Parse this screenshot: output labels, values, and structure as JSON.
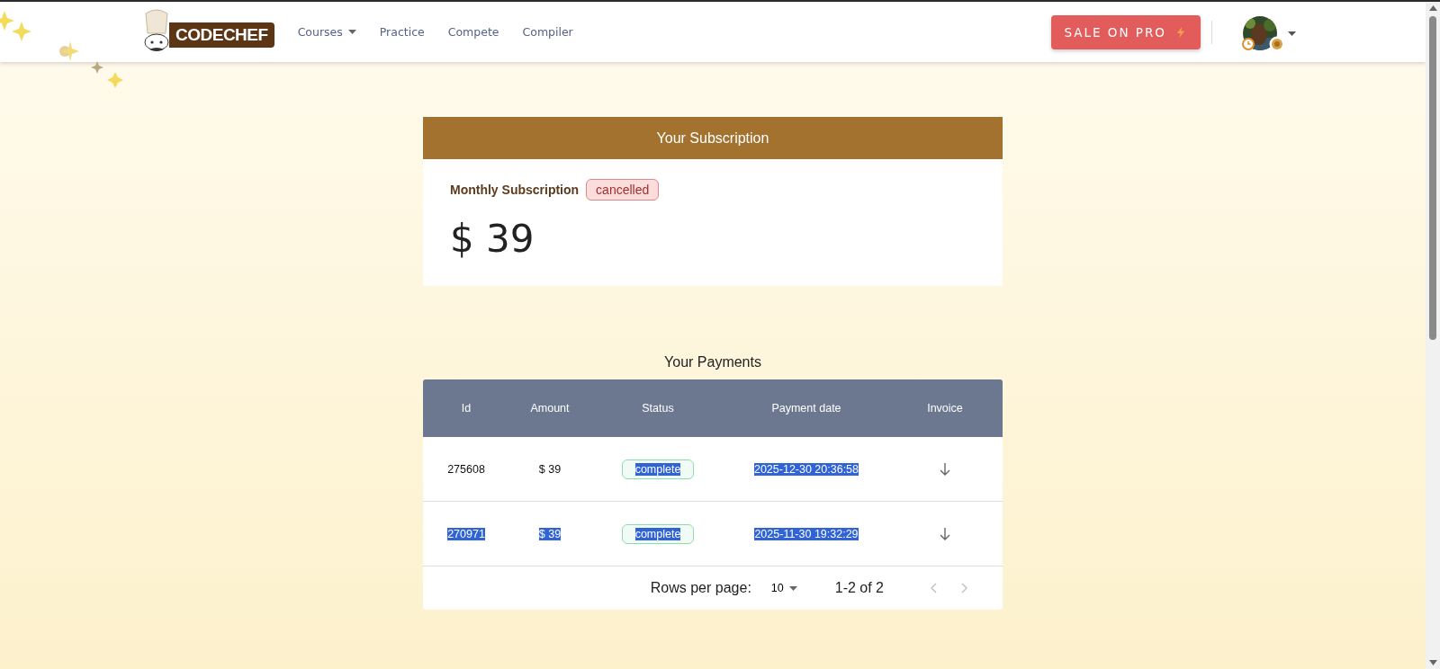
{
  "header": {
    "logo_text": "CODECHEF",
    "nav": [
      {
        "label": "Courses",
        "dropdown": true
      },
      {
        "label": "Practice",
        "dropdown": false
      },
      {
        "label": "Compete",
        "dropdown": false
      },
      {
        "label": "Compiler",
        "dropdown": false
      }
    ],
    "sale_button": "SALE ON PRO"
  },
  "subscription": {
    "title": "Your Subscription",
    "plan": "Monthly Subscription",
    "status": "cancelled",
    "price": "$ 39"
  },
  "payments": {
    "title": "Your Payments",
    "columns": [
      "Id",
      "Amount",
      "Status",
      "Payment date",
      "Invoice"
    ],
    "rows": [
      {
        "id": {
          "text": "275608",
          "highlighted": false
        },
        "amount": {
          "text": "$ 39",
          "highlighted": false
        },
        "status": {
          "text": "complete",
          "highlighted": true
        },
        "date": {
          "text": "2025-12-30 20:36:58",
          "highlighted": true
        }
      },
      {
        "id": {
          "text": "270971",
          "highlighted": true
        },
        "amount": {
          "text": "$ 39",
          "highlighted": true
        },
        "status": {
          "text": "complete",
          "highlighted": true
        },
        "date": {
          "text": "2025-11-30 19:32:29",
          "highlighted": true
        }
      }
    ],
    "footer": {
      "rows_label": "Rows per page:",
      "rows_value": "10",
      "range": "1-2 of 2",
      "prev_disabled": true,
      "next_disabled": true
    }
  }
}
